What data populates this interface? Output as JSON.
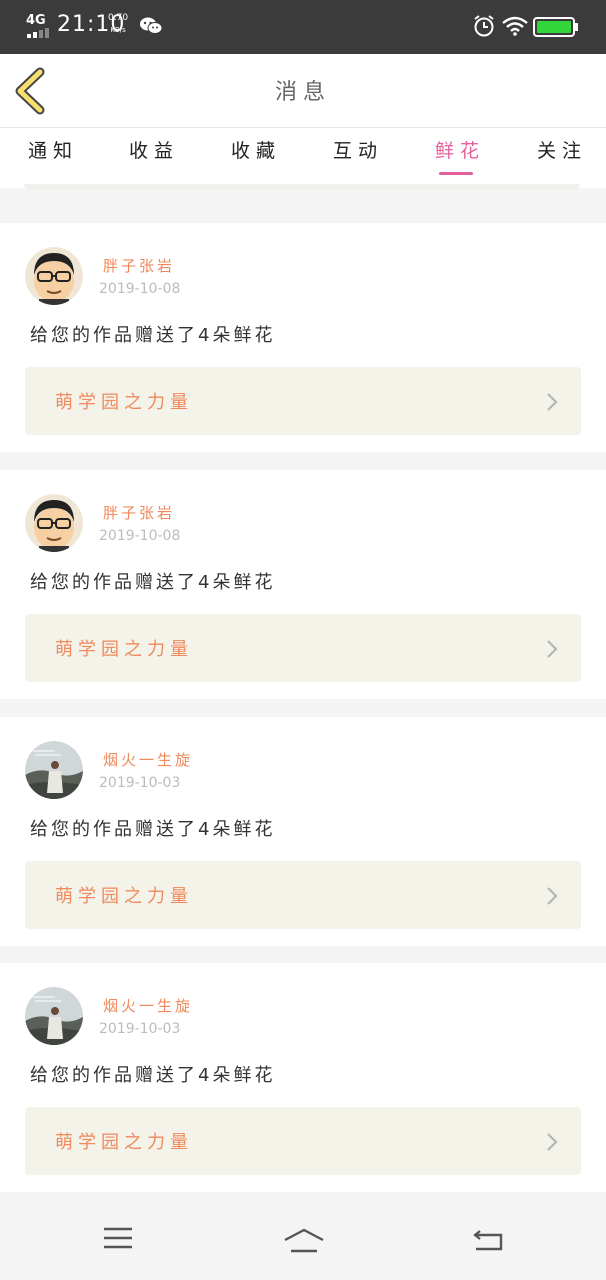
{
  "status_bar": {
    "network": "4G",
    "time": "21:10",
    "speed_value": "0.70",
    "speed_unit": "KB/s",
    "battery_color": "#31d63a"
  },
  "header": {
    "title": "消息",
    "back_icon": "chevron-left-icon"
  },
  "tabs": [
    {
      "label": "通知",
      "active": false
    },
    {
      "label": "收益",
      "active": false
    },
    {
      "label": "收藏",
      "active": false
    },
    {
      "label": "互动",
      "active": false
    },
    {
      "label": "鲜花",
      "active": true
    },
    {
      "label": "关注",
      "active": false
    }
  ],
  "colors": {
    "accent": "#e4609d",
    "username": "#f08a5d",
    "link_bg": "#f3f3ea"
  },
  "messages": [
    {
      "user": "胖子张岩",
      "date": "2019-10-08",
      "text": "给您的作品赠送了4朵鲜花",
      "work": "萌学园之力量",
      "avatar": "cartoon-man-avatar"
    },
    {
      "user": "胖子张岩",
      "date": "2019-10-08",
      "text": "给您的作品赠送了4朵鲜花",
      "work": "萌学园之力量",
      "avatar": "cartoon-man-avatar"
    },
    {
      "user": "烟火一生旋",
      "date": "2019-10-03",
      "text": "给您的作品赠送了4朵鲜花",
      "work": "萌学园之力量",
      "avatar": "photo-woman-avatar"
    },
    {
      "user": "烟火一生旋",
      "date": "2019-10-03",
      "text": "给您的作品赠送了4朵鲜花",
      "work": "萌学园之力量",
      "avatar": "photo-woman-avatar"
    }
  ],
  "nav_bar": {
    "items": [
      "menu-icon",
      "home-icon",
      "back-icon"
    ]
  }
}
